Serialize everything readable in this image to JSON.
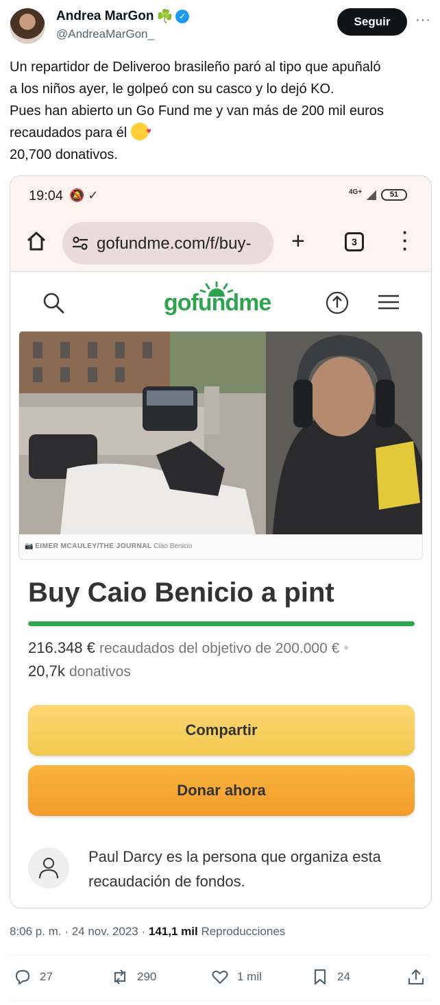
{
  "tweet": {
    "author_name": "Andrea MarGon",
    "author_emoji": "☘️",
    "handle": "@AndreaMarGon_",
    "follow_label": "Seguir",
    "more_label": "···",
    "text_lines": [
      "Un repartidor de Deliveroo brasileño paró al tipo que apuñaló",
      "a los niños ayer, le golpeó con su casco y lo dejó KO.",
      "Pues han abierto un Go Fund me y van más de 200 mil euros",
      "recaudados para él",
      "20,700 donativos."
    ],
    "time": "8:06 p. m.",
    "date": "24 nov. 2023",
    "views_count": "141,1 mil",
    "views_label": "Reproducciones"
  },
  "actions": {
    "replies": "27",
    "retweets": "290",
    "likes": "1 mil",
    "bookmarks": "24"
  },
  "phone": {
    "time": "19:04",
    "status_icons": "🔕 ✓",
    "network": "4G+",
    "battery": "51",
    "url": "gofundme.com/f/buy-",
    "tab_count": "3"
  },
  "gofundme": {
    "logo": "gofundme",
    "photo_credit_source": "EIMER MCAULEY/THE JOURNAL",
    "photo_credit_caption": "Ciao Benicio",
    "campaign_title": "Buy Caio Benicio a pint",
    "progress_fraction": 1.0,
    "raised_amount": "216.348 €",
    "raised_text": "recaudados del objetivo de 200.000 €",
    "donations_count": "20,7k",
    "donations_label": "donativos",
    "share_label": "Compartir",
    "donate_label": "Donar ahora",
    "organizer_text": "Paul Darcy es la persona que organiza esta recaudación de fondos."
  },
  "colors": {
    "gofundme_green": "#2fa44f",
    "share_yellow": "#f3c84e",
    "donate_orange": "#f39b2a",
    "verified_blue": "#1d9bf0"
  }
}
